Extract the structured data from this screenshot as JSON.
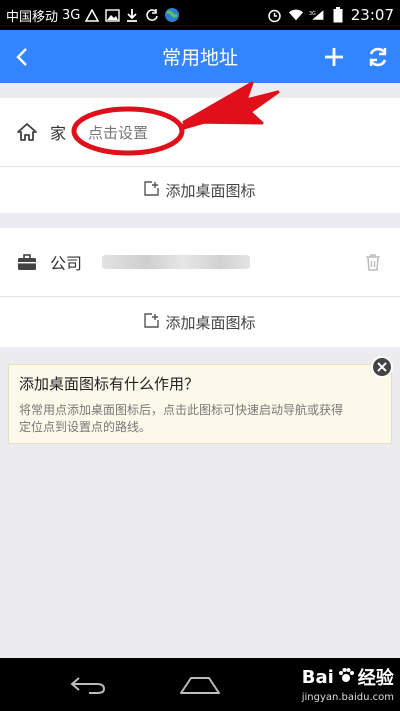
{
  "statusbar": {
    "carrier": "中国移动",
    "network": "3G",
    "time": "23:07"
  },
  "appbar": {
    "title": "常用地址"
  },
  "home": {
    "label": "家",
    "value": "点击设置",
    "add_label": "添加桌面图标"
  },
  "company": {
    "label": "公司",
    "add_label": "添加桌面图标"
  },
  "tip": {
    "title": "添加桌面图标有什么作用？",
    "line1": "将常用点添加桌面图标后，点击此图标可快速启动导航或获得",
    "line2": "定位点到设置点的路线。"
  },
  "watermark": {
    "brand": "Bai",
    "brand2": "经验",
    "url": "jingyan.baidu.com"
  },
  "colors": {
    "accent": "#3385ff",
    "annotation": "#e0101a"
  }
}
